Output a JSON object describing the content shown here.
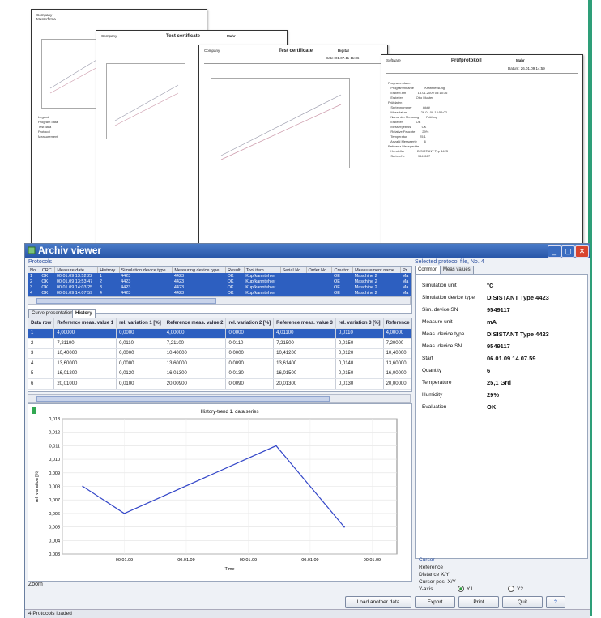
{
  "app": {
    "title": "Archiv viewer",
    "status_text": "4 Protocols loaded"
  },
  "background_sheets": {
    "sheet1": {
      "company": "Company",
      "subline": "Musterfirma",
      "path": "C:\\...\\Data\\DD\\PDFF\\0Y17_25_36_946 mesured\\0423"
    },
    "sheet2": {
      "company": "Company",
      "subline": "Musterfirma",
      "doc_title": "Test certificate",
      "brand": "Mahr"
    },
    "sheet3": {
      "company": "Company",
      "subline": "Musterfirma",
      "doc_title": "Test certificate",
      "brand": "Digital",
      "version": "Version: V2006.2.0.0",
      "date": "Date: 01.07.11 11:36"
    },
    "sheet4": {
      "company": "Software",
      "subline": "Mahr Meister",
      "doc_title": "Prüfprotokoll",
      "brand": "Mahr",
      "version": "Version: V2006.2.0.0",
      "date": "Datum: 26.01.09 14:59",
      "page": "Seite 1/1"
    }
  },
  "protocols": {
    "section_label": "Protocols",
    "columns": [
      "No.",
      "CRC",
      "Measure date",
      "Histrory",
      "Simulation device type",
      "Measuring device type",
      "Result",
      "Tool item",
      "Serial No.",
      "Order No.",
      "Creator",
      "Measurement name",
      "Pr"
    ],
    "rows": [
      [
        "1",
        "OK",
        "00.01.09 13:52:22",
        "1",
        "4423",
        "4423",
        "OK",
        "Kupfkanntehler",
        "",
        "",
        "OE",
        "Maschine 2",
        "Ma"
      ],
      [
        "2",
        "OK",
        "00.01.09 13:53:47",
        "2",
        "4423",
        "4423",
        "OK",
        "Kupfkanntehler",
        "",
        "",
        "OE",
        "Maschine 2",
        "Ma"
      ],
      [
        "3",
        "OK",
        "00.01.09 14:03:25",
        "3",
        "4423",
        "4423",
        "OK",
        "Kupfkanntehler",
        "",
        "",
        "OE",
        "Maschine 2",
        "Ma"
      ],
      [
        "4",
        "OK",
        "00.01.09 14:07:59",
        "4",
        "4423",
        "4423",
        "OK",
        "Kupfkanntehler",
        "",
        "",
        "OE",
        "Maschine 2",
        "Ma"
      ]
    ]
  },
  "tabs": {
    "curve": "Curve presentation",
    "history": "History"
  },
  "history": {
    "columns": [
      "Data row",
      "Reference meas. value 1",
      "rel. variation 1 [%]",
      "Reference meas. value 2",
      "rel. variation 2 [%]",
      "Reference meas. value 3",
      "rel. variation 3 [%]",
      "Reference meas. v"
    ],
    "rows": [
      [
        "1",
        "4,00000",
        "0,0000",
        "4,00000",
        "0,0000",
        "4,01100",
        "0,0110",
        "4,00000"
      ],
      [
        "2",
        "7,21100",
        "0,0110",
        "7,21100",
        "0,0110",
        "7,21500",
        "0,0150",
        "7,20000"
      ],
      [
        "3",
        "10,40000",
        "0,0000",
        "10,40000",
        "0,0000",
        "10,41200",
        "0,0120",
        "10,40000"
      ],
      [
        "4",
        "13,60000",
        "0,0000",
        "13,60000",
        "0,0090",
        "13,61400",
        "0,0140",
        "13,60000"
      ],
      [
        "5",
        "16,01200",
        "0,0120",
        "16,01300",
        "0,0130",
        "16,01500",
        "0,0150",
        "16,00000"
      ],
      [
        "6",
        "20,01000",
        "0,0100",
        "20,00900",
        "0,0090",
        "20,01300",
        "0,0130",
        "20,00000"
      ]
    ]
  },
  "chart_data": {
    "type": "line",
    "title": "History-trend 1. data series",
    "xlabel": "Time",
    "ylabel": "rel. variation [%]",
    "x_tick_labels": [
      "00.01.09",
      "00.01.09",
      "00.01.09",
      "00.01.09",
      "00.01.09",
      "00.01.09"
    ],
    "y_ticks": [
      0.003,
      0.004,
      0.005,
      0.006,
      0.007,
      0.008,
      0.009,
      0.01,
      0.011,
      0.012,
      0.013
    ],
    "y_tick_labels": [
      "0,003",
      "0,004",
      "0,005",
      "0,006",
      "0,007",
      "0,008",
      "0,009",
      "0,010",
      "0,011",
      "0,012",
      "0,013"
    ],
    "ylim": [
      0.003,
      0.013
    ],
    "series": [
      {
        "points": [
          [
            0.33,
            0.008
          ],
          [
            1,
            0.006
          ],
          [
            3.45,
            0.011
          ],
          [
            4.55,
            0.005
          ]
        ],
        "color": "#3346c8"
      }
    ],
    "xlim": [
      0,
      5.4
    ],
    "grid": true
  },
  "zoom_label": "Zoom",
  "buttons": {
    "load": "Load another data",
    "export": "Export",
    "print": "Print",
    "quit": "Quit",
    "help": "?"
  },
  "right_panel": {
    "header": "Selected protocol file, No. 4",
    "tab_common": "Common",
    "tab_meas": "Meas values",
    "properties": [
      {
        "key": "Simulation unit",
        "value": "°C"
      },
      {
        "key": "Simulation device type",
        "value": "DISISTANT Type 4423"
      },
      {
        "key": "Sim. device SN",
        "value": "9549117"
      },
      {
        "key": "Measure unit",
        "value": "mA"
      },
      {
        "key": "Meas. device type",
        "value": "DISISTANT Type 4423"
      },
      {
        "key": "Meas. device SN",
        "value": "9549117"
      },
      {
        "key": "Start",
        "value": "06.01.09 14.07.59"
      },
      {
        "key": "Quantity",
        "value": "6"
      },
      {
        "key": "Temperature",
        "value": "25,1 Grd"
      },
      {
        "key": "Humidity",
        "value": "29%"
      },
      {
        "key": "Evaluation",
        "value": "OK"
      }
    ],
    "cursor": {
      "label": "Cursor",
      "reference": "Reference",
      "distance": "Distance X/Y",
      "cursor_pos": "Cursor pos. X/Y",
      "y_axis": "Y-axis",
      "y1": "Y1",
      "y2": "Y2"
    }
  }
}
